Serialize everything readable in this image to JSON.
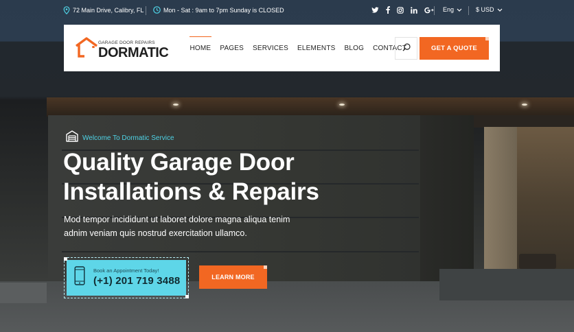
{
  "topbar": {
    "address": "72 Main Drive, Calibry, FL",
    "hours": "Mon - Sat : 9am to 7pm Sunday is CLOSED",
    "social": [
      "twitter-icon",
      "facebook-icon",
      "instagram-icon",
      "linkedin-icon",
      "google-plus-icon"
    ],
    "language": "Eng",
    "currency": "$ USD"
  },
  "logo": {
    "tagline": "GARAGE DOOR REPAIRS",
    "name": "DORMATIC"
  },
  "nav": {
    "items": [
      "HOME",
      "PAGES",
      "SERVICES",
      "ELEMENTS",
      "BLOG",
      "CONTACT"
    ],
    "active": "HOME"
  },
  "header": {
    "quote_label": "GET A QUOTE"
  },
  "hero": {
    "welcome": "Welcome To Dormatic Service",
    "title_line1": "Quality Garage Door",
    "title_line2": "Installations & Repairs",
    "subtitle_line1": "Mod tempor incididunt ut laboret dolore magna aliqua tenim",
    "subtitle_line2": "adnim veniam quis nostrud exercitation ullamco.",
    "appointment_label": "Book an Appointment Today!",
    "phone": "(+1) 201 719 3488",
    "more_label": "LEARN MORE"
  },
  "colors": {
    "accent": "#f26722",
    "cyan": "#5ed6e8",
    "topbar_bg": "#2b3b4d"
  }
}
